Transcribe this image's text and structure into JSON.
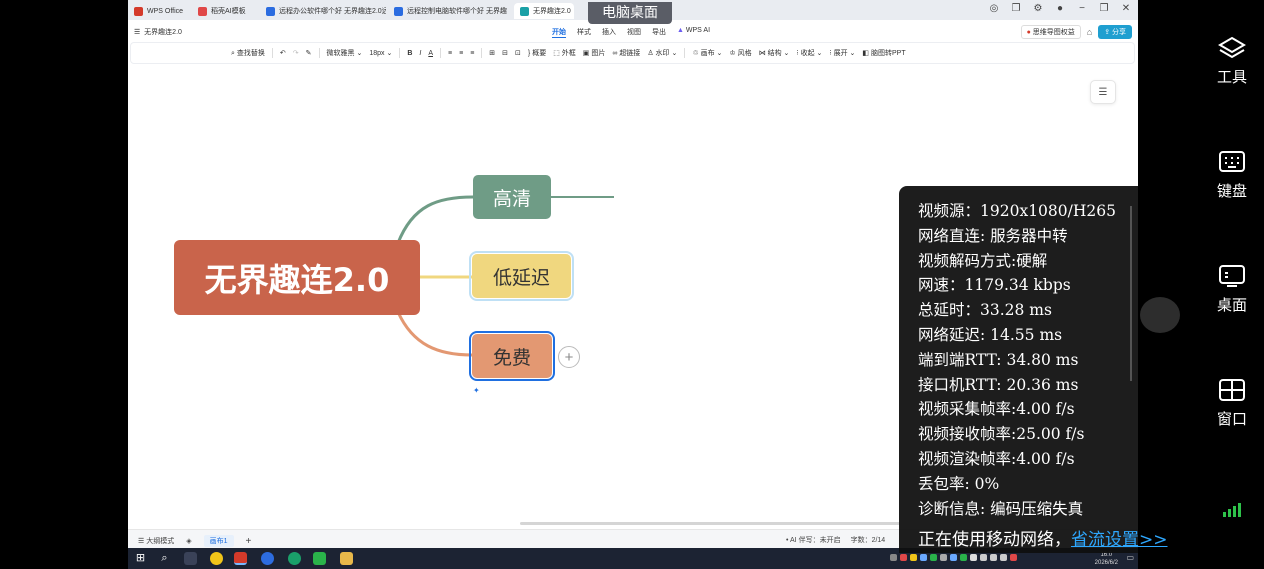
{
  "tabs": [
    {
      "label": "WPS Office",
      "color": "#d43a2a"
    },
    {
      "label": "稻壳AI模板",
      "color": "#e04848"
    },
    {
      "label": "远程办公软件哪个好 无界趣连2.0远",
      "color": "#2b6ce0"
    },
    {
      "label": "远程控制电脑软件哪个好 无界趣",
      "color": "#2b6ce0"
    },
    {
      "label": "无界趣连2.0",
      "color": "#1aa0a6"
    }
  ],
  "desktop_label": "电脑桌面",
  "doc_name": "无界趣连2.0",
  "menus": [
    "开始",
    "样式",
    "插入",
    "视图",
    "导出"
  ],
  "wps_ai": "WPS AI",
  "permission_label": "思维导图权益",
  "share_label": "分享",
  "toolbar": {
    "find_replace": "查找替换",
    "font": "微软雅黑",
    "font_size": "18px",
    "summary": "概要",
    "border": "外框",
    "image": "图片",
    "hyperlink": "超链接",
    "watermark": "水印",
    "canvas": "画布",
    "style": "风格",
    "structure": "结构",
    "collapse": "收起",
    "expand": "展开",
    "to_ppt": "脑图转PPT"
  },
  "mindmap": {
    "root": "无界趣连2.0",
    "children": [
      "高清",
      "低延迟",
      "免费"
    ],
    "colors": {
      "root": "#c9644b",
      "child1": "#6f9c86",
      "child2": "#f0d77f",
      "child3": "#e39872"
    }
  },
  "statusbar": {
    "outline_mode": "大纲模式",
    "sheet": "画布1",
    "ai_status": "AI 伴写：未开启",
    "word_count": "字数：2/14"
  },
  "clock": {
    "time": "16:0",
    "date": "2026/6/2"
  },
  "stats": {
    "lines": [
      "视频源：1920x1080/H265",
      "网络直连: 服务器中转",
      "视频解码方式:硬解",
      "网速：1179.34 kbps",
      "总延时：33.28 ms",
      "网络延迟: 14.55 ms",
      "端到端RTT: 34.80 ms",
      "接口机RTT: 20.36 ms",
      "视频采集帧率:4.00 f/s",
      "视频接收帧率:25.00 f/s",
      "视频渲染帧率:4.00 f/s",
      "丢包率: 0%",
      "诊断信息: 编码压缩失真"
    ],
    "network_text": "正在使用移动网络，",
    "network_link": "省流设置>>"
  },
  "side_panel": {
    "tools": "工具",
    "keyboard": "键盘",
    "desktop": "桌面",
    "window": "窗口"
  }
}
